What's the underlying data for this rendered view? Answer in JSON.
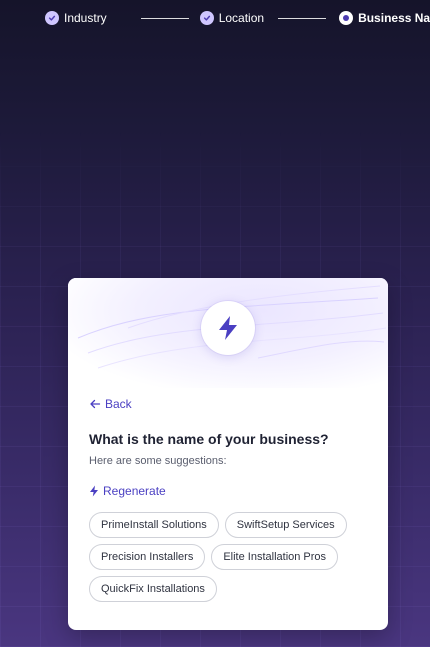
{
  "stepper": {
    "steps": [
      {
        "label": "Industry",
        "state": "complete"
      },
      {
        "label": "Location",
        "state": "complete"
      },
      {
        "label": "Business Name",
        "state": "current"
      }
    ]
  },
  "card": {
    "hero_icon": "lightning-bolt-icon",
    "back_label": "Back",
    "title": "What is the name of your business?",
    "subtitle": "Here are some suggestions:",
    "regenerate_label": "Regenerate",
    "suggestions": [
      "PrimeInstall Solutions",
      "SwiftSetup Services",
      "Precision Installers",
      "Elite Installation Pros",
      "QuickFix Installations"
    ]
  },
  "colors": {
    "accent": "#4a3fc2",
    "background_top": "#15142a",
    "background_bottom": "#4a3680",
    "card": "#ffffff"
  }
}
